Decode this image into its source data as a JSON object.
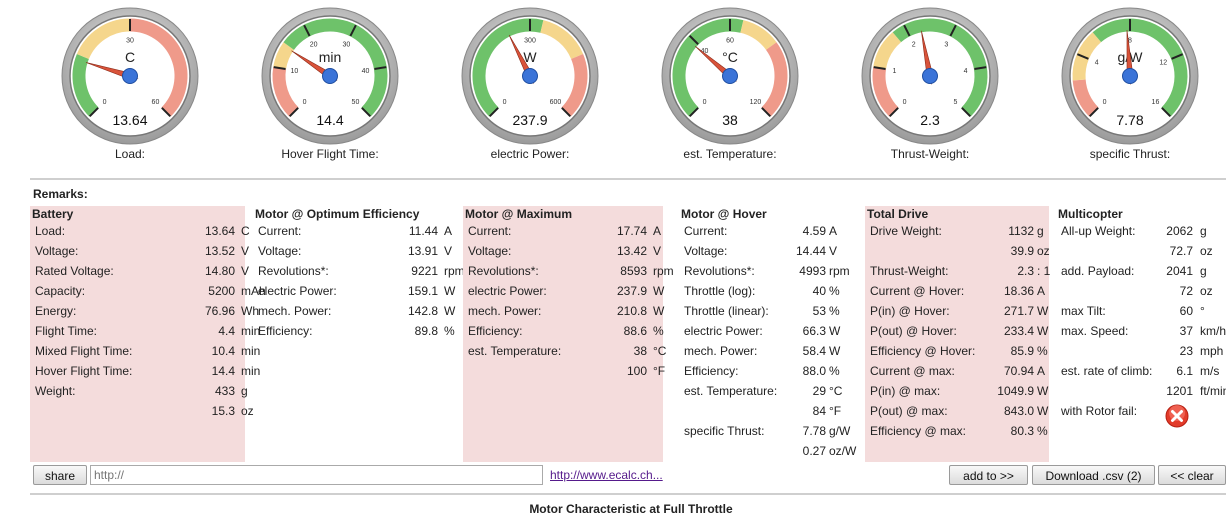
{
  "colors": {
    "green": "#6ec26a",
    "yellow": "#f5d68c",
    "red": "#ef9a8a",
    "needle": "#d9533a",
    "hub": "#3b74d8",
    "pink": "#f4dcdc"
  },
  "gauges": [
    {
      "id": "load",
      "unit": "C",
      "value": "13.64",
      "caption": "Load:",
      "ticks": [
        {
          "t": "0",
          "f": 0
        },
        {
          "t": "30",
          "f": 0.5
        },
        {
          "t": "60",
          "f": 1
        }
      ],
      "zones": [
        [
          "green",
          0,
          0.25
        ],
        [
          "yellow",
          0.25,
          0.5
        ],
        [
          "red",
          0.5,
          1
        ]
      ],
      "needle": 0.23
    },
    {
      "id": "hover",
      "unit": "min",
      "value": "14.4",
      "caption": "Hover Flight Time:",
      "ticks": [
        {
          "t": "0",
          "f": 0
        },
        {
          "t": "10",
          "f": 0.2
        },
        {
          "t": "20",
          "f": 0.4
        },
        {
          "t": "30",
          "f": 0.6
        },
        {
          "t": "40",
          "f": 0.8
        },
        {
          "t": "50",
          "f": 1
        }
      ],
      "zones": [
        [
          "red",
          0,
          0.2
        ],
        [
          "yellow",
          0.2,
          0.3
        ],
        [
          "green",
          0.3,
          1
        ]
      ],
      "needle": 0.29
    },
    {
      "id": "power",
      "unit": "W",
      "value": "237.9",
      "caption": "electric Power:",
      "ticks": [
        {
          "t": "0",
          "f": 0
        },
        {
          "t": "300",
          "f": 0.5
        },
        {
          "t": "600",
          "f": 1
        }
      ],
      "zones": [
        [
          "green",
          0,
          0.55
        ],
        [
          "yellow",
          0.55,
          0.75
        ],
        [
          "red",
          0.75,
          1
        ]
      ],
      "needle": 0.4
    },
    {
      "id": "temp",
      "unit": "°C",
      "value": "38",
      "caption": "est. Temperature:",
      "ticks": [
        {
          "t": "0",
          "f": 0
        },
        {
          "t": "40",
          "f": 0.333
        },
        {
          "t": "60",
          "f": 0.5
        },
        {
          "t": "120",
          "f": 1
        }
      ],
      "zones": [
        [
          "green",
          0,
          0.55
        ],
        [
          "yellow",
          0.55,
          0.7
        ],
        [
          "red",
          0.7,
          1
        ]
      ],
      "needle": 0.317
    },
    {
      "id": "thrust",
      "unit": "",
      "value": "2.3",
      "caption": "Thrust-Weight:",
      "ticks": [
        {
          "t": "0",
          "f": 0
        },
        {
          "t": "1",
          "f": 0.2
        },
        {
          "t": "2",
          "f": 0.4
        },
        {
          "t": "3",
          "f": 0.6
        },
        {
          "t": "4",
          "f": 0.8
        },
        {
          "t": "5",
          "f": 1
        }
      ],
      "zones": [
        [
          "red",
          0,
          0.2
        ],
        [
          "yellow",
          0.2,
          0.35
        ],
        [
          "green",
          0.35,
          1
        ]
      ],
      "needle": 0.46
    },
    {
      "id": "spec",
      "unit": "g/W",
      "value": "7.78",
      "caption": "specific Thrust:",
      "ticks": [
        {
          "t": "0",
          "f": 0
        },
        {
          "t": "4",
          "f": 0.25
        },
        {
          "t": "8",
          "f": 0.5
        },
        {
          "t": "12",
          "f": 0.75
        },
        {
          "t": "16",
          "f": 1
        }
      ],
      "zones": [
        [
          "red",
          0,
          0.15
        ],
        [
          "yellow",
          0.15,
          0.35
        ],
        [
          "green",
          0.35,
          1
        ]
      ],
      "needle": 0.486
    }
  ],
  "remarks_label": "Remarks:",
  "columns": [
    {
      "title": "Battery",
      "pink": true,
      "rows": [
        [
          "Load:",
          "13.64",
          "C"
        ],
        [
          "Voltage:",
          "13.52",
          "V"
        ],
        [
          "Rated Voltage:",
          "14.80",
          "V"
        ],
        [
          "Capacity:",
          "5200",
          "mAh"
        ],
        [
          "Energy:",
          "76.96",
          "Wh"
        ],
        [
          "Flight Time:",
          "4.4",
          "min"
        ],
        [
          "Mixed Flight Time:",
          "10.4",
          "min"
        ],
        [
          "Hover Flight Time:",
          "14.4",
          "min"
        ],
        [
          "Weight:",
          "433",
          "g"
        ],
        [
          "",
          "15.3",
          "oz"
        ]
      ]
    },
    {
      "title": "Motor @ Optimum Efficiency",
      "pink": false,
      "rows": [
        [
          "Current:",
          "11.44",
          "A"
        ],
        [
          "Voltage:",
          "13.91",
          "V"
        ],
        [
          "Revolutions*:",
          "9221",
          "rpm"
        ],
        [
          "electric Power:",
          "159.1",
          "W"
        ],
        [
          "mech. Power:",
          "142.8",
          "W"
        ],
        [
          "Efficiency:",
          "89.8",
          "%"
        ]
      ]
    },
    {
      "title": "Motor @ Maximum",
      "pink": true,
      "rows": [
        [
          "Current:",
          "17.74",
          "A"
        ],
        [
          "Voltage:",
          "13.42",
          "V"
        ],
        [
          "Revolutions*:",
          "8593",
          "rpm"
        ],
        [
          "electric Power:",
          "237.9",
          "W"
        ],
        [
          "mech. Power:",
          "210.8",
          "W"
        ],
        [
          "Efficiency:",
          "88.6",
          "%"
        ],
        [
          "est. Temperature:",
          "38",
          "°C"
        ],
        [
          "",
          "100",
          "°F"
        ]
      ]
    },
    {
      "title": "Motor @ Hover",
      "pink": false,
      "rows": [
        [
          "Current:",
          "4.59",
          "A"
        ],
        [
          "Voltage:",
          "14.44",
          "V"
        ],
        [
          "Revolutions*:",
          "4993",
          "rpm"
        ],
        [
          "Throttle (log):",
          "40",
          "%"
        ],
        [
          "Throttle (linear):",
          "53",
          "%"
        ],
        [
          "electric Power:",
          "66.3",
          "W"
        ],
        [
          "mech. Power:",
          "58.4",
          "W"
        ],
        [
          "Efficiency:",
          "88.0",
          "%"
        ],
        [
          "est. Temperature:",
          "29",
          "°C"
        ],
        [
          "",
          "84",
          "°F"
        ],
        [
          "specific Thrust:",
          "7.78",
          "g/W"
        ],
        [
          "",
          "0.27",
          "oz/W"
        ]
      ]
    },
    {
      "title": "Total Drive",
      "pink": true,
      "rows": [
        [
          "Drive Weight:",
          "1132",
          "g"
        ],
        [
          "",
          "39.9",
          "oz"
        ],
        [
          "Thrust-Weight:",
          "2.3",
          ": 1"
        ],
        [
          "Current @ Hover:",
          "18.36",
          "A"
        ],
        [
          "P(in) @ Hover:",
          "271.7",
          "W"
        ],
        [
          "P(out) @ Hover:",
          "233.4",
          "W"
        ],
        [
          "Efficiency @ Hover:",
          "85.9",
          "%"
        ],
        [
          "Current @ max:",
          "70.94",
          "A"
        ],
        [
          "P(in) @ max:",
          "1049.9",
          "W"
        ],
        [
          "P(out) @ max:",
          "843.0",
          "W"
        ],
        [
          "Efficiency @ max:",
          "80.3",
          "%"
        ]
      ]
    },
    {
      "title": "Multicopter",
      "pink": false,
      "rows": [
        [
          "All-up Weight:",
          "2062",
          "g"
        ],
        [
          "",
          "72.7",
          "oz"
        ],
        [
          "add. Payload:",
          "2041",
          "g"
        ],
        [
          "",
          "72",
          "oz"
        ],
        [
          "max Tilt:",
          "60",
          "°"
        ],
        [
          "max. Speed:",
          "37",
          "km/h"
        ],
        [
          "",
          "23",
          "mph"
        ],
        [
          "est. rate of climb:",
          "6.1",
          "m/s"
        ],
        [
          "",
          "1201",
          "ft/min"
        ],
        [
          "with Rotor fail:",
          "",
          ""
        ]
      ]
    }
  ],
  "toolbar": {
    "share_label": "share",
    "url_placeholder": "http://",
    "link_text": "http://www.ecalc.ch...",
    "add_label": "add to >>",
    "download_label": "Download .csv (2)",
    "clear_label": "<< clear"
  },
  "footer_title": "Motor Characteristic at Full Throttle"
}
